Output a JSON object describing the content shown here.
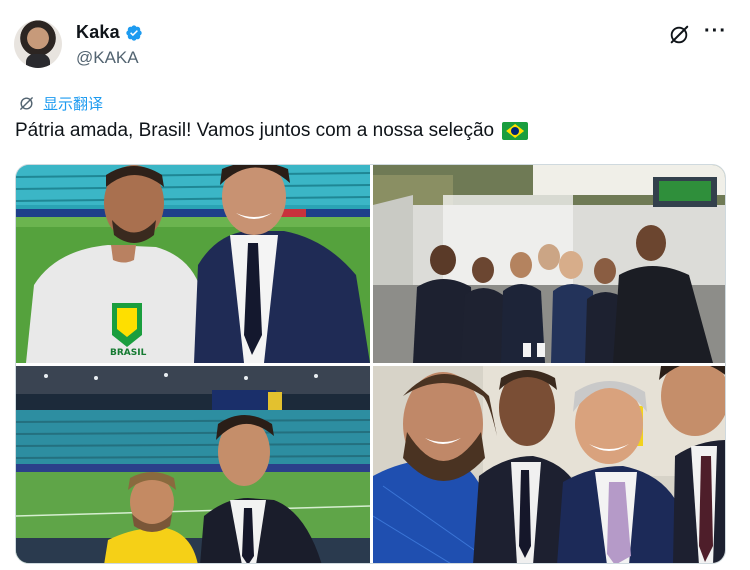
{
  "author": {
    "display_name": "Kaka",
    "handle": "@KAKA",
    "verified_color": "#1d9bf0"
  },
  "translate": {
    "label": "显示翻译"
  },
  "tweet": {
    "text": "Pátria amada, Brasil! Vamos juntos com a nossa seleção",
    "emoji": "brazil-flag"
  },
  "colors": {
    "accent": "#1d9bf0",
    "secondary_text": "#536471",
    "stadium_seats": "#2aa3b4",
    "pitch": "#4f9a3c"
  },
  "photo_texts": {
    "jersey_word": "BRASIL"
  },
  "icons": [
    "verified-badge-icon",
    "grok-icon",
    "more-options-icon",
    "translate-icon",
    "brazil-flag-emoji"
  ]
}
